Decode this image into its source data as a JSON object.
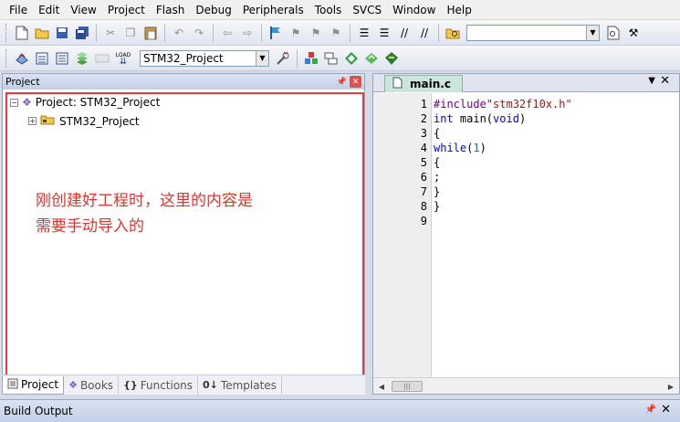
{
  "menu": [
    "File",
    "Edit",
    "View",
    "Project",
    "Flash",
    "Debug",
    "Peripherals",
    "Tools",
    "SVCS",
    "Window",
    "Help"
  ],
  "toolbar": {
    "target_select": "STM32_Project",
    "load_label": "LOAD"
  },
  "project_pane": {
    "title": "Project",
    "pin_glyph": "⨯",
    "close_glyph": "✕",
    "root_label": "Project: STM32_Project",
    "target_label": "STM32_Project",
    "annotation_line1": "刚创建好工程时，这里的内容是",
    "annotation_line2": "需要手动导入的"
  },
  "bottom_tabs": [
    {
      "label": "Project",
      "icon": "project-tab-icon"
    },
    {
      "label": "Books",
      "icon": "books-icon"
    },
    {
      "label": "Functions",
      "icon": "functions-icon"
    },
    {
      "label": "Templates",
      "icon": "templates-icon"
    }
  ],
  "editor": {
    "tab_label": "main.c",
    "line_numbers": [
      "1",
      "2",
      "3",
      "4",
      "5",
      "6",
      "7",
      "8",
      "9"
    ],
    "lines": [
      "#include\"stm32f10x.h\"",
      "int main(void)",
      "{",
      "while(1)",
      "{",
      ";",
      "}",
      "}",
      ""
    ]
  },
  "build_output": {
    "title": "Build Output"
  },
  "colors": {
    "annotation": "#e0332f",
    "frame": "#e43d3d",
    "keyword": "#0000ff",
    "string": "#a31515",
    "number": "#098658",
    "file_tab": "#c9e5dc"
  }
}
